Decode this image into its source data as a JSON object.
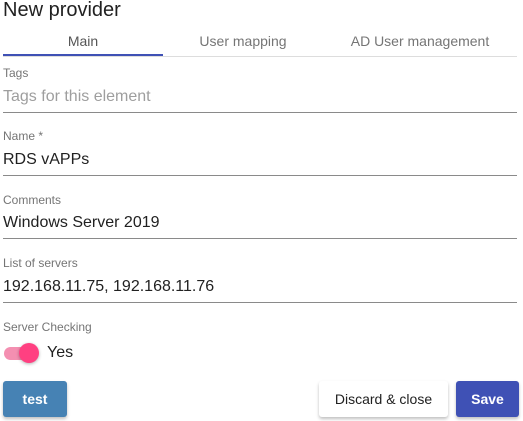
{
  "title": "New provider",
  "tabs": [
    "Main",
    "User mapping",
    "AD User management"
  ],
  "fields": {
    "tags": {
      "label": "Tags",
      "placeholder": "Tags for this element"
    },
    "name": {
      "label": "Name *",
      "value": "RDS vAPPs"
    },
    "comments": {
      "label": "Comments",
      "value": "Windows Server 2019"
    },
    "servers": {
      "label": "List of servers",
      "value": "192.168.11.75, 192.168.11.76"
    },
    "server_checking": {
      "label": "Server Checking",
      "value": "Yes",
      "on": true
    }
  },
  "buttons": {
    "test": "test",
    "discard": "Discard & close",
    "save": "Save"
  },
  "colors": {
    "accent": "#3f51b5",
    "toggle": "#ff4081",
    "test": "#4682b4"
  }
}
